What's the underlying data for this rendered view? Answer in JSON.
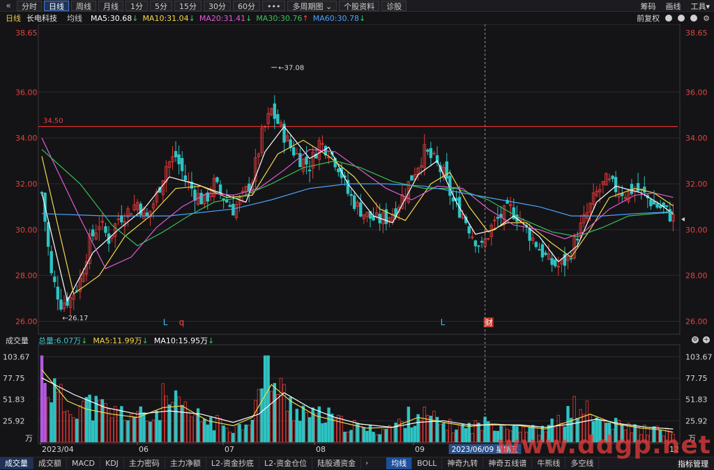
{
  "toolbar": {
    "back_icon": "chevron-double-left-icon",
    "tabs": [
      "分时",
      "日线",
      "周线",
      "月线",
      "1分",
      "5分",
      "15分",
      "30分",
      "60分",
      "•••",
      "多周期图",
      "个股资料",
      "诊股"
    ],
    "active_tab": "日线",
    "dropdown_marker": "⌄",
    "right_links": [
      "筹码",
      "画线",
      "工具▾"
    ]
  },
  "infobar": {
    "period": "日线",
    "stock_name": "长电科技",
    "line_type": "均线",
    "ma": [
      {
        "label": "MA5:30.68",
        "arrow": "↓",
        "color": "#ffffff"
      },
      {
        "label": "MA10:31.04",
        "arrow": "↓",
        "color": "#f5d94a"
      },
      {
        "label": "MA20:31.41",
        "arrow": "↓",
        "color": "#e35bd6"
      },
      {
        "label": "MA30:30.76",
        "arrow": "↑",
        "color": "#38c15a"
      },
      {
        "label": "MA60:30.78",
        "arrow": "↓",
        "color": "#4aa3ff"
      }
    ],
    "right_label": "前复权",
    "right_icons": [
      "help-icon",
      "zoom-in-icon",
      "zoom-out-icon",
      "settings-icon"
    ]
  },
  "price_axis": {
    "top_value": "38.65",
    "ticks": [
      "36.00",
      "34.00",
      "32.00",
      "30.00",
      "28.00",
      "26.00"
    ]
  },
  "annotations": {
    "high": "37.08",
    "low": "26.17",
    "hline": "34.50",
    "markers": [
      "L",
      "q",
      "L",
      "财"
    ]
  },
  "volume": {
    "header_title": "成交量",
    "total": "总量:6.07万",
    "total_arrow": "↓",
    "ma5": "MA5:11.99万",
    "ma5_arrow": "↓",
    "ma10": "MA10:15.95万",
    "ma10_arrow": "↓",
    "ticks": [
      "103.67",
      "77.75",
      "51.83",
      "25.92"
    ],
    "unit": "万"
  },
  "x_axis": {
    "labels": [
      "2023/04",
      "06",
      "07",
      "08",
      "09",
      "10",
      "12"
    ],
    "cursor_label": "2023/06/09 星期五"
  },
  "bottom_tabs": {
    "left": [
      "成交量",
      "成交额",
      "MACD",
      "KDJ",
      "主力密码",
      "主力净额",
      "L2-资金抄底",
      "L2-资金仓位",
      "陆股通资金"
    ],
    "right": [
      "均线",
      "BOLL",
      "神奇九转",
      "神奇五线谱",
      "牛熊线",
      "多空线"
    ],
    "last": "指标管理"
  },
  "watermark": "www.ddgp.net",
  "chart_data": {
    "type": "candlestick",
    "price_range": [
      25.5,
      38.65
    ],
    "volume_range": [
      0,
      110
    ],
    "trend_points": [
      [
        0,
        31.6
      ],
      [
        3,
        28.0
      ],
      [
        6,
        26.8
      ],
      [
        9,
        27.0
      ],
      [
        12,
        27.8
      ],
      [
        15,
        29.5
      ],
      [
        18,
        30.3
      ],
      [
        21,
        29.6
      ],
      [
        24,
        30.5
      ],
      [
        27,
        30.8
      ],
      [
        30,
        31.2
      ],
      [
        33,
        30.5
      ],
      [
        36,
        31.5
      ],
      [
        39,
        32.8
      ],
      [
        42,
        33.2
      ],
      [
        45,
        32.2
      ],
      [
        48,
        31.6
      ],
      [
        51,
        31.2
      ],
      [
        54,
        32.0
      ],
      [
        57,
        31.4
      ],
      [
        60,
        30.9
      ],
      [
        63,
        31.4
      ],
      [
        66,
        32.2
      ],
      [
        69,
        34.1
      ],
      [
        72,
        35.2
      ],
      [
        75,
        34.4
      ],
      [
        78,
        33.6
      ],
      [
        81,
        33.1
      ],
      [
        84,
        32.8
      ],
      [
        87,
        33.8
      ],
      [
        90,
        33.5
      ],
      [
        93,
        32.8
      ],
      [
        96,
        31.6
      ],
      [
        99,
        31.0
      ],
      [
        102,
        30.6
      ],
      [
        105,
        30.4
      ],
      [
        108,
        30.5
      ],
      [
        111,
        30.9
      ],
      [
        114,
        31.7
      ],
      [
        117,
        32.6
      ],
      [
        120,
        33.4
      ],
      [
        123,
        33.0
      ],
      [
        126,
        32.4
      ],
      [
        129,
        31.2
      ],
      [
        132,
        30.7
      ],
      [
        135,
        29.8
      ],
      [
        138,
        29.2
      ],
      [
        141,
        30.1
      ],
      [
        144,
        30.6
      ],
      [
        147,
        30.9
      ],
      [
        150,
        30.5
      ],
      [
        153,
        29.8
      ],
      [
        156,
        29.2
      ],
      [
        159,
        28.6
      ],
      [
        162,
        28.4
      ],
      [
        165,
        28.7
      ],
      [
        168,
        29.8
      ],
      [
        171,
        30.7
      ],
      [
        174,
        31.6
      ],
      [
        177,
        32.1
      ],
      [
        180,
        31.8
      ],
      [
        183,
        31.6
      ],
      [
        186,
        31.8
      ],
      [
        189,
        31.5
      ],
      [
        192,
        31.1
      ],
      [
        195,
        30.9
      ],
      [
        198,
        30.5
      ]
    ],
    "volume_points": [
      [
        0,
        103
      ],
      [
        2,
        72
      ],
      [
        5,
        55
      ],
      [
        8,
        40
      ],
      [
        11,
        48
      ],
      [
        14,
        45
      ],
      [
        17,
        42
      ],
      [
        20,
        38
      ],
      [
        23,
        35
      ],
      [
        26,
        36
      ],
      [
        29,
        33
      ],
      [
        32,
        30
      ],
      [
        35,
        28
      ],
      [
        38,
        50
      ],
      [
        41,
        45
      ],
      [
        44,
        40
      ],
      [
        47,
        32
      ],
      [
        50,
        28
      ],
      [
        53,
        25
      ],
      [
        56,
        22
      ],
      [
        59,
        20
      ],
      [
        62,
        18
      ],
      [
        65,
        30
      ],
      [
        68,
        55
      ],
      [
        71,
        105
      ],
      [
        73,
        70
      ],
      [
        76,
        55
      ],
      [
        79,
        42
      ],
      [
        82,
        38
      ],
      [
        85,
        30
      ],
      [
        88,
        32
      ],
      [
        91,
        28
      ],
      [
        94,
        22
      ],
      [
        97,
        20
      ],
      [
        100,
        18
      ],
      [
        103,
        15
      ],
      [
        106,
        14
      ],
      [
        109,
        18
      ],
      [
        112,
        22
      ],
      [
        115,
        30
      ],
      [
        118,
        35
      ],
      [
        121,
        30
      ],
      [
        124,
        25
      ],
      [
        127,
        20
      ],
      [
        130,
        18
      ],
      [
        133,
        18
      ],
      [
        136,
        20
      ],
      [
        139,
        22
      ],
      [
        142,
        24
      ],
      [
        145,
        22
      ],
      [
        148,
        20
      ],
      [
        151,
        18
      ],
      [
        154,
        15
      ],
      [
        157,
        14
      ],
      [
        160,
        20
      ],
      [
        163,
        28
      ],
      [
        166,
        35
      ],
      [
        169,
        48
      ],
      [
        172,
        30
      ],
      [
        175,
        25
      ],
      [
        178,
        22
      ],
      [
        181,
        20
      ],
      [
        184,
        18
      ],
      [
        187,
        16
      ],
      [
        190,
        15
      ],
      [
        193,
        14
      ],
      [
        196,
        13
      ],
      [
        198,
        8
      ]
    ],
    "ma_series": [
      {
        "name": "MA5",
        "color": "#ffffff",
        "points": [
          [
            0,
            31.6
          ],
          [
            8,
            26.9
          ],
          [
            16,
            29.0
          ],
          [
            24,
            30.0
          ],
          [
            32,
            30.9
          ],
          [
            40,
            32.3
          ],
          [
            48,
            32.0
          ],
          [
            56,
            31.6
          ],
          [
            64,
            31.2
          ],
          [
            70,
            33.4
          ],
          [
            76,
            34.5
          ],
          [
            84,
            33.1
          ],
          [
            90,
            33.6
          ],
          [
            96,
            32.0
          ],
          [
            104,
            30.6
          ],
          [
            110,
            30.3
          ],
          [
            118,
            32.4
          ],
          [
            124,
            33.0
          ],
          [
            130,
            31.2
          ],
          [
            136,
            29.8
          ],
          [
            142,
            30.0
          ],
          [
            148,
            30.6
          ],
          [
            156,
            29.7
          ],
          [
            162,
            28.6
          ],
          [
            168,
            29.3
          ],
          [
            174,
            31.2
          ],
          [
            180,
            31.9
          ],
          [
            188,
            31.6
          ],
          [
            194,
            31.1
          ],
          [
            198,
            30.68
          ]
        ]
      },
      {
        "name": "MA10",
        "color": "#f5d94a",
        "points": [
          [
            0,
            33.2
          ],
          [
            10,
            27.2
          ],
          [
            18,
            28.0
          ],
          [
            26,
            29.7
          ],
          [
            34,
            30.6
          ],
          [
            42,
            31.8
          ],
          [
            50,
            31.9
          ],
          [
            58,
            31.4
          ],
          [
            66,
            31.5
          ],
          [
            74,
            33.3
          ],
          [
            82,
            33.9
          ],
          [
            90,
            33.2
          ],
          [
            98,
            32.3
          ],
          [
            106,
            30.9
          ],
          [
            114,
            30.4
          ],
          [
            122,
            32.0
          ],
          [
            128,
            32.5
          ],
          [
            134,
            31.0
          ],
          [
            140,
            29.9
          ],
          [
            146,
            30.3
          ],
          [
            152,
            30.3
          ],
          [
            160,
            29.4
          ],
          [
            166,
            28.8
          ],
          [
            172,
            30.0
          ],
          [
            178,
            31.4
          ],
          [
            186,
            31.8
          ],
          [
            192,
            31.6
          ],
          [
            198,
            31.04
          ]
        ]
      },
      {
        "name": "MA20",
        "color": "#e35bd6",
        "points": [
          [
            0,
            34.0
          ],
          [
            12,
            30.5
          ],
          [
            20,
            28.3
          ],
          [
            28,
            28.8
          ],
          [
            36,
            30.1
          ],
          [
            44,
            31.0
          ],
          [
            52,
            31.6
          ],
          [
            60,
            31.5
          ],
          [
            68,
            31.8
          ],
          [
            76,
            32.6
          ],
          [
            84,
            33.5
          ],
          [
            92,
            33.4
          ],
          [
            100,
            32.6
          ],
          [
            108,
            31.8
          ],
          [
            116,
            31.3
          ],
          [
            124,
            31.9
          ],
          [
            132,
            31.8
          ],
          [
            140,
            30.9
          ],
          [
            148,
            30.2
          ],
          [
            156,
            30.0
          ],
          [
            164,
            29.6
          ],
          [
            170,
            29.9
          ],
          [
            178,
            30.9
          ],
          [
            186,
            31.5
          ],
          [
            192,
            31.6
          ],
          [
            198,
            31.41
          ]
        ]
      },
      {
        "name": "MA30",
        "color": "#38c15a",
        "points": [
          [
            0,
            33.5
          ],
          [
            12,
            32.0
          ],
          [
            22,
            30.2
          ],
          [
            30,
            29.3
          ],
          [
            38,
            29.9
          ],
          [
            46,
            30.6
          ],
          [
            54,
            31.2
          ],
          [
            62,
            31.4
          ],
          [
            72,
            32.0
          ],
          [
            82,
            32.7
          ],
          [
            92,
            33.0
          ],
          [
            100,
            32.7
          ],
          [
            110,
            32.1
          ],
          [
            120,
            31.8
          ],
          [
            130,
            31.8
          ],
          [
            140,
            31.3
          ],
          [
            150,
            30.5
          ],
          [
            160,
            29.9
          ],
          [
            168,
            29.7
          ],
          [
            176,
            30.1
          ],
          [
            184,
            30.6
          ],
          [
            192,
            30.7
          ],
          [
            198,
            30.76
          ]
        ]
      },
      {
        "name": "MA60",
        "color": "#4aa3ff",
        "points": [
          [
            0,
            30.7
          ],
          [
            20,
            30.6
          ],
          [
            40,
            30.6
          ],
          [
            60,
            30.9
          ],
          [
            72,
            31.3
          ],
          [
            84,
            31.8
          ],
          [
            96,
            32.0
          ],
          [
            108,
            32.0
          ],
          [
            120,
            31.9
          ],
          [
            132,
            31.6
          ],
          [
            144,
            31.3
          ],
          [
            156,
            31.0
          ],
          [
            166,
            30.6
          ],
          [
            176,
            30.6
          ],
          [
            186,
            30.7
          ],
          [
            198,
            30.78
          ]
        ]
      }
    ],
    "vol_ma": [
      {
        "name": "MA5",
        "color": "#f5d94a",
        "points": [
          [
            0,
            88
          ],
          [
            8,
            50
          ],
          [
            14,
            40
          ],
          [
            22,
            34
          ],
          [
            30,
            30
          ],
          [
            38,
            42
          ],
          [
            44,
            44
          ],
          [
            52,
            26
          ],
          [
            60,
            20
          ],
          [
            66,
            30
          ],
          [
            72,
            70
          ],
          [
            78,
            50
          ],
          [
            86,
            32
          ],
          [
            94,
            24
          ],
          [
            102,
            17
          ],
          [
            110,
            18
          ],
          [
            118,
            30
          ],
          [
            126,
            24
          ],
          [
            134,
            19
          ],
          [
            142,
            22
          ],
          [
            150,
            20
          ],
          [
            158,
            16
          ],
          [
            166,
            26
          ],
          [
            172,
            34
          ],
          [
            180,
            22
          ],
          [
            188,
            17
          ],
          [
            194,
            15
          ],
          [
            198,
            12
          ]
        ]
      },
      {
        "name": "MA10",
        "color": "#ffffff",
        "points": [
          [
            0,
            78
          ],
          [
            10,
            58
          ],
          [
            20,
            42
          ],
          [
            30,
            34
          ],
          [
            40,
            38
          ],
          [
            50,
            34
          ],
          [
            60,
            24
          ],
          [
            68,
            34
          ],
          [
            76,
            60
          ],
          [
            84,
            42
          ],
          [
            92,
            30
          ],
          [
            100,
            22
          ],
          [
            110,
            18
          ],
          [
            118,
            24
          ],
          [
            126,
            26
          ],
          [
            134,
            21
          ],
          [
            142,
            21
          ],
          [
            150,
            21
          ],
          [
            158,
            18
          ],
          [
            166,
            22
          ],
          [
            174,
            28
          ],
          [
            182,
            22
          ],
          [
            190,
            18
          ],
          [
            198,
            16
          ]
        ]
      }
    ]
  }
}
